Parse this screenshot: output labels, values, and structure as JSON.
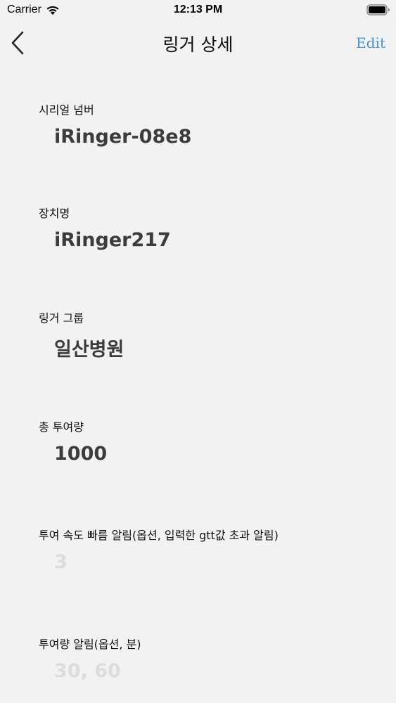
{
  "status_bar": {
    "carrier": "Carrier",
    "time": "12:13 PM"
  },
  "nav": {
    "title": "링거 상세",
    "edit_label": "Edit",
    "accent_color": "#4a90d9"
  },
  "fields": [
    {
      "label": "시리얼 넘버",
      "value": "iRinger-08e8"
    },
    {
      "label": "장치명",
      "value": "iRinger217"
    },
    {
      "label": "링거 그룹",
      "value": "일산병원"
    },
    {
      "label": "총 투여량",
      "value": "1000"
    },
    {
      "label": "투여 속도 빠름 알림(옵션, 입력한 gtt값 초과 알림)",
      "placeholder": "3"
    },
    {
      "label": "투여량 알림(옵션, 분)",
      "placeholder": "30, 60"
    }
  ]
}
